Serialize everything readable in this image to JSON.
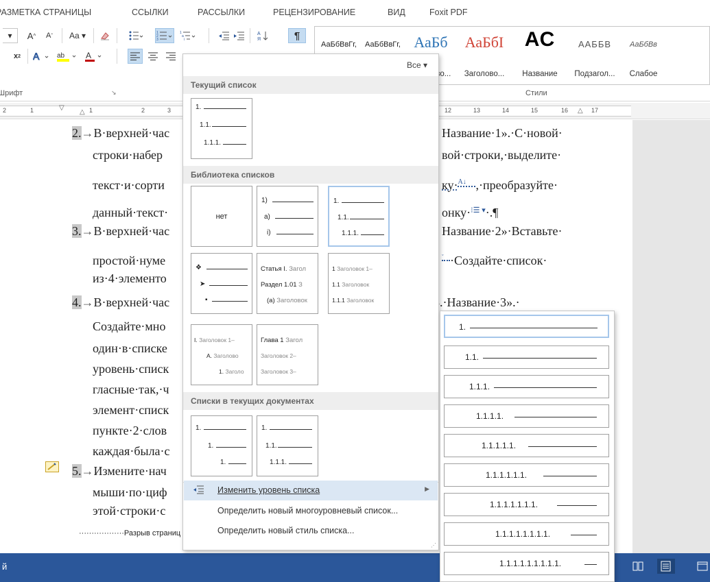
{
  "ribbon": {
    "tabs": [
      "РАЗМЕТКА СТРАНИЦЫ",
      "ССЫЛКИ",
      "РАССЫЛКИ",
      "РЕЦЕНЗИРОВАНИЕ",
      "ВИД",
      "Foxit PDF"
    ],
    "font_group_label": "Шрифт",
    "styles_group_label": "Стили",
    "show_marks_symbol": "¶",
    "styles": [
      {
        "sample": "АаБбВвГг,",
        "name": ""
      },
      {
        "sample": "АаБбВвГг,",
        "name": ""
      },
      {
        "sample": "АаБб",
        "name": "Заголово..."
      },
      {
        "sample": "АаБбІ",
        "name": "Заголово..."
      },
      {
        "sample": "АС",
        "name": "Название"
      },
      {
        "sample": "ААББВ",
        "name": "Подзагол..."
      },
      {
        "sample": "АаБбВв",
        "name": "Слабое"
      }
    ],
    "style_colors": {
      "heading": "#2e74b5",
      "heading2": "#d04437",
      "title": "#000000"
    }
  },
  "ruler": {
    "numbers": [
      "2",
      "1",
      "1",
      "2",
      "3",
      "12",
      "13",
      "14",
      "15",
      "16",
      "17"
    ]
  },
  "document": {
    "item2_num": "2.",
    "item2_line1_left": "В·верхней·час",
    "item2_line1_right": "Название·1».·С·новой·",
    "item2_line2_left": "строки·набер",
    "item2_line2_right": "вой·строки,·выделите·",
    "item2_line3_left": "текст·и·сорти",
    "item2_line3_right": "ку·",
    "item2_line3_tail": ",·преобразуйте·",
    "item2_line4_left": "данный·текст·",
    "item2_line4_right": "онку·",
    "item2_line4_tail": "·.¶",
    "item3_num": "3.",
    "item3_line1_left": "В·верхней·час",
    "item3_line1_right": "Название·2»·Вставьте·",
    "item3_line2_left": "простой·нуме",
    "item3_line2_right": "·Создайте·список·",
    "item3_line3_left": "из·4·элементо",
    "item4_num": "4.",
    "item4_line1_left": "В·верхней·час",
    "item4_line1_right": "3.·Название·3».·",
    "item4_lines": [
      "Создайте·мно",
      "один·в·списке",
      "уровень·списк",
      "гласные·так,·ч",
      "элемент·списк",
      "пункте·2·слов",
      "каждая·была·с"
    ],
    "item5_num": "5.",
    "item5_lines": [
      "Измените·нач",
      "мыши·по·циф",
      "этой·строки·с"
    ],
    "page_break": "··················Разрыв страниц"
  },
  "dropdown": {
    "all_label": "Все ▾",
    "current_header": "Текущий список",
    "library_header": "Библиотека списков",
    "docs_header": "Списки в текущих документах",
    "current_tile": [
      "1.",
      "1.1.",
      "1.1.1."
    ],
    "none_label": "нет",
    "tile_paren": [
      "1)",
      "a)",
      "i)"
    ],
    "tile_decimal": [
      "1.",
      "1.1.",
      "1.1.1."
    ],
    "tile_bullets": [
      "❖",
      "➤",
      "▪"
    ],
    "tile_article": [
      {
        "b": "Статья I.",
        "g": "Загол"
      },
      {
        "b": "Раздел 1.01",
        "g": "З"
      },
      {
        "b": "(а)",
        "g": "Заголовок"
      }
    ],
    "tile_heading_num": [
      {
        "b": "1",
        "g": "Заголовок 1–"
      },
      {
        "b": "1.1",
        "g": "Заголовок"
      },
      {
        "b": "1.1.1",
        "g": "Заголовок"
      }
    ],
    "tile_roman": [
      {
        "b": "I.",
        "g": "Заголовок 1–"
      },
      {
        "b": "A.",
        "g": "Заголово"
      },
      {
        "b": "1.",
        "g": "Заголо"
      }
    ],
    "tile_chapter": [
      {
        "b": "Глава 1",
        "g": "Загол"
      },
      {
        "b": "",
        "g": "Заголовок 2–"
      },
      {
        "b": "",
        "g": "Заголовок 3–"
      }
    ],
    "doc_tile1": [
      "1.",
      "1.",
      "1."
    ],
    "doc_tile2": [
      "1.",
      "1.1.",
      "1.1.1."
    ],
    "menu_change_level": "Изменить уровень списка",
    "menu_define_multilevel": "Определить новый многоуровневый список...",
    "menu_define_style": "Определить новый стиль списка..."
  },
  "submenu": {
    "levels": [
      "1.",
      "1.1.",
      "1.1.1.",
      "1.1.1.1.",
      "1.1.1.1.1.",
      "1.1.1.1.1.1.",
      "1.1.1.1.1.1.1.",
      "1.1.1.1.1.1.1.1.",
      "1.1.1.1.1.1.1.1.1."
    ]
  },
  "status_bar": {
    "left_label": "й"
  }
}
